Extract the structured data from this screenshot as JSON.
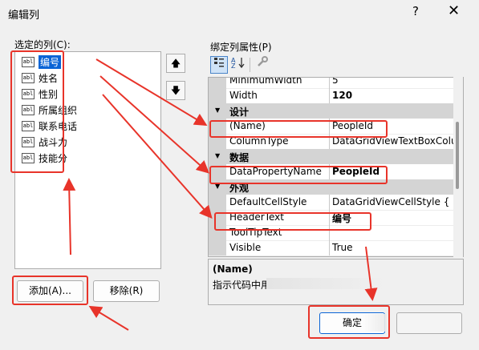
{
  "window": {
    "title": "编辑列",
    "help_label": "?",
    "close_label": "✕"
  },
  "left": {
    "label": "选定的列(C):",
    "columns": [
      {
        "name": "编号"
      },
      {
        "name": "姓名"
      },
      {
        "name": "性别"
      },
      {
        "name": "所属组织"
      },
      {
        "name": "联系电话"
      },
      {
        "name": "战斗力"
      },
      {
        "name": "技能分"
      }
    ],
    "column_icon_text": "abl",
    "add_button": "添加(A)...",
    "remove_button": "移除(R)",
    "move_up_glyph": "🡅",
    "move_down_glyph": "🡇"
  },
  "right": {
    "label": "绑定列属性(P)",
    "properties": [
      {
        "kind": "item",
        "name": "MinimumWidth",
        "value": "5",
        "bold": false
      },
      {
        "kind": "item",
        "name": "Width",
        "value": "120",
        "bold": true
      },
      {
        "kind": "cat",
        "name": "设计"
      },
      {
        "kind": "item",
        "name": "(Name)",
        "value": "PeopleId",
        "bold": false
      },
      {
        "kind": "item",
        "name": "ColumnType",
        "value": "DataGridViewTextBoxColu",
        "bold": false
      },
      {
        "kind": "cat",
        "name": "数据"
      },
      {
        "kind": "item",
        "name": "DataPropertyName",
        "value": "PeopleId",
        "bold": true
      },
      {
        "kind": "cat",
        "name": "外观"
      },
      {
        "kind": "item",
        "name": "DefaultCellStyle",
        "value": "DataGridViewCellStyle { }",
        "bold": false
      },
      {
        "kind": "item",
        "name": "HeaderText",
        "value": "编号",
        "bold": true
      },
      {
        "kind": "item",
        "name": "ToolTipText",
        "value": "",
        "bold": false
      },
      {
        "kind": "item",
        "name": "Visible",
        "value": "True",
        "bold": false
      }
    ],
    "description": {
      "title": "(Name)",
      "text": "指示代码中用"
    }
  },
  "footer": {
    "ok_button": "确定"
  },
  "colors": {
    "highlight": "#e8342a",
    "selection": "#0a64d6",
    "category_bg": "#d4d4d4"
  }
}
